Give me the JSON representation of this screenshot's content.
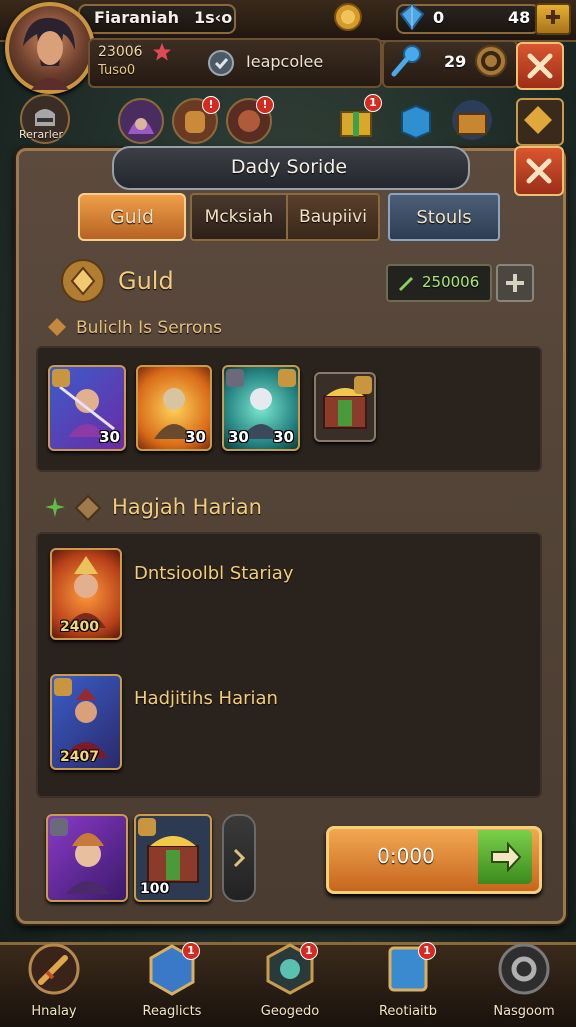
{
  "top_bar": {
    "player_name": "Fiaraniah",
    "level_text": "1s‹o",
    "gems": "0",
    "coins": "48"
  },
  "profile": {
    "stat_1": "23006",
    "stat_2": "Tuso0",
    "guild_button": "Ieapcolee",
    "energy": "29",
    "portrait_label": "Rerarler"
  },
  "panel": {
    "title": "Dady Soride",
    "tabs": [
      "Guld",
      "Mcksiah",
      "Baupiivi",
      "Stouls"
    ],
    "guild_title": "Guld",
    "currency_value": "250006",
    "section1_label": "Buliclh Is Serrons",
    "section1_cards": [
      "30",
      "30",
      "30",
      "30"
    ],
    "section2_title": "Hagjah Harian",
    "rewards": [
      {
        "title": "Dntsioolbl Stariay",
        "value": "2400"
      },
      {
        "title": "Hadjitihs Harian",
        "value": "2407"
      }
    ],
    "bottom_card_value": "100",
    "timer": "0:000"
  },
  "bottom_nav": [
    "Hnalay",
    "Reaglicts",
    "Geogedo",
    "Reotiaitb",
    "Nasgoom"
  ],
  "colors": {
    "accent_gold": "#c8963e",
    "accent_red": "#c63e22",
    "accent_orange": "#e0862c",
    "accent_green": "#5fae3a"
  }
}
